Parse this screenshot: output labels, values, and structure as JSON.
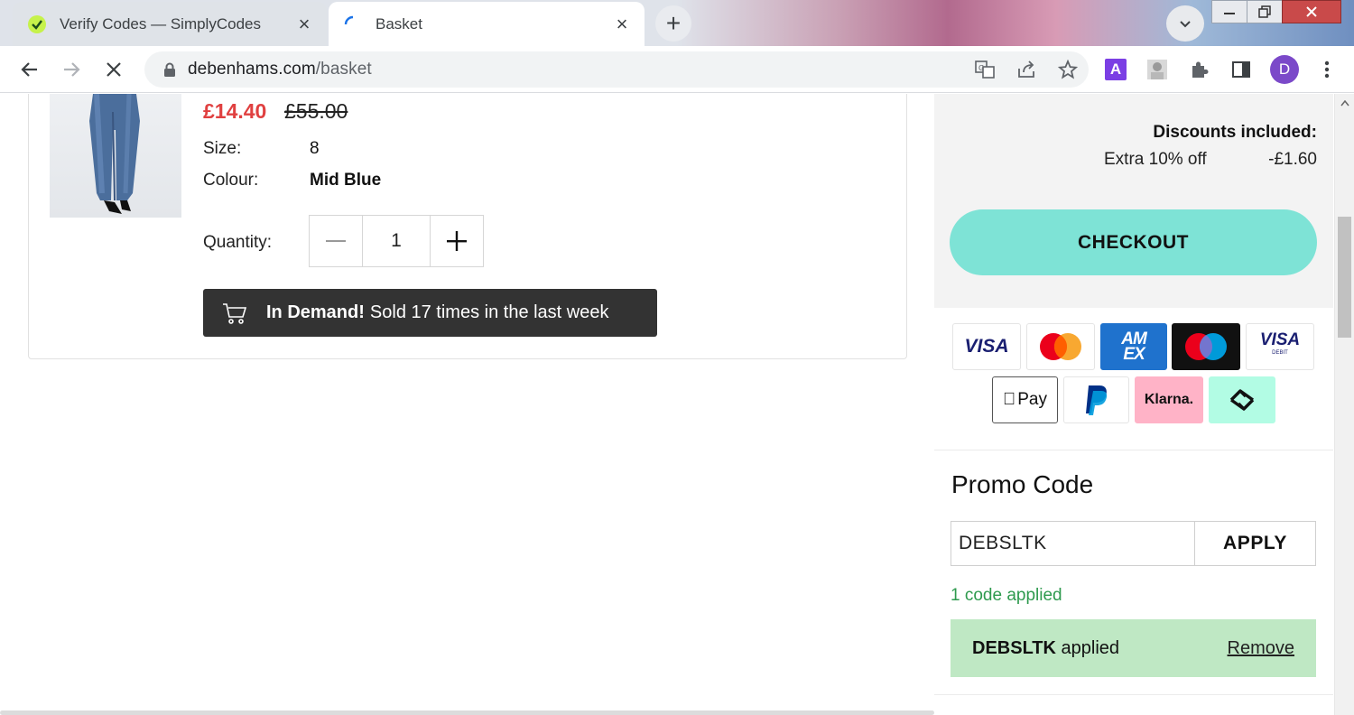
{
  "browser": {
    "tabs": [
      {
        "title": "Verify Codes — SimplyCodes",
        "active": false
      },
      {
        "title": "Basket",
        "active": true
      }
    ],
    "url_domain": "debenhams.com",
    "url_path": "/basket",
    "profile_initial": "D",
    "extension_letter": "A"
  },
  "item": {
    "price_now": "£14.40",
    "price_was": "£55.00",
    "size_label": "Size:",
    "size_value": "8",
    "colour_label": "Colour:",
    "colour_value": "Mid Blue",
    "quantity_label": "Quantity:",
    "quantity_value": "1",
    "demand_bold": "In Demand!",
    "demand_text": "Sold 17 times in the last week"
  },
  "summary": {
    "discounts_title": "Discounts included:",
    "discount_name": "Extra 10% off",
    "discount_amount": "-£1.60",
    "checkout_label": "CHECKOUT"
  },
  "payment_methods": {
    "visa": "VISA",
    "apple_pay": "Pay",
    "klarna": "Klarna.",
    "amex_1": "AM",
    "amex_2": "EX",
    "visa_debit": "VISA",
    "visa_debit_small": "DEBIT"
  },
  "promo": {
    "title": "Promo Code",
    "input_value": "DEBSLTK",
    "apply_label": "APPLY",
    "applied_count": "1 code applied",
    "applied_code": "DEBSLTK",
    "applied_suffix": "applied",
    "remove_label": "Remove"
  },
  "colors": {
    "accent_checkout": "#7ee3d6",
    "sale_red": "#e04040",
    "success_green": "#2e9a4e",
    "applied_bg": "#bfe8c4"
  }
}
